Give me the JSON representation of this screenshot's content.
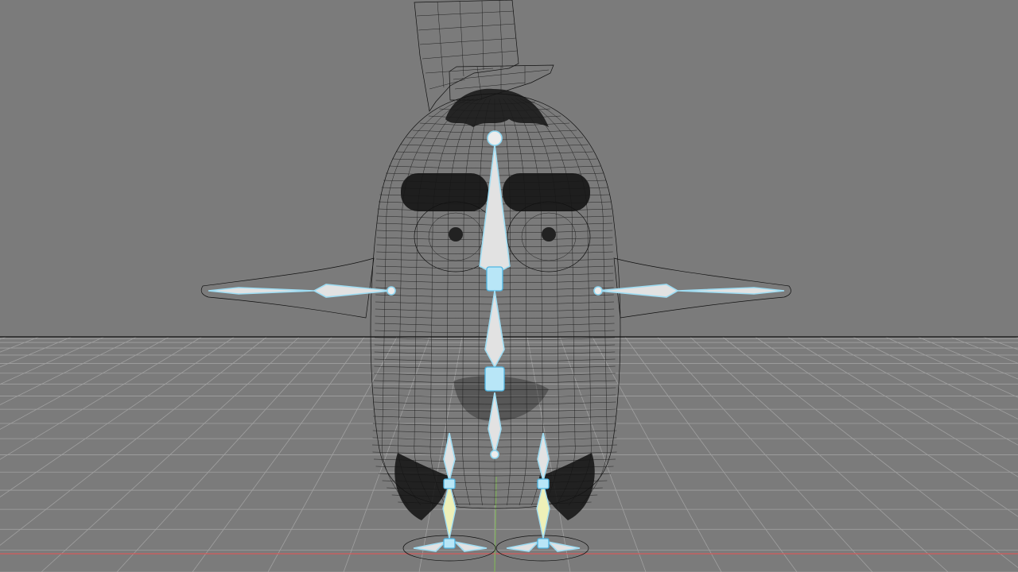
{
  "viewport": {
    "background_color": "#7b7b7b",
    "grid_color": "#a0a0a0",
    "horizon_color": "#111111",
    "x_axis_color": "#d25b5b",
    "y_axis_color": "#7fb05a",
    "wireframe_color": "#111111",
    "bone_color": "#e2e2e2",
    "bone_outline_color": "#9fdcf2",
    "icons": [
      "rig-character",
      "armature-bones",
      "floor-grid"
    ]
  }
}
